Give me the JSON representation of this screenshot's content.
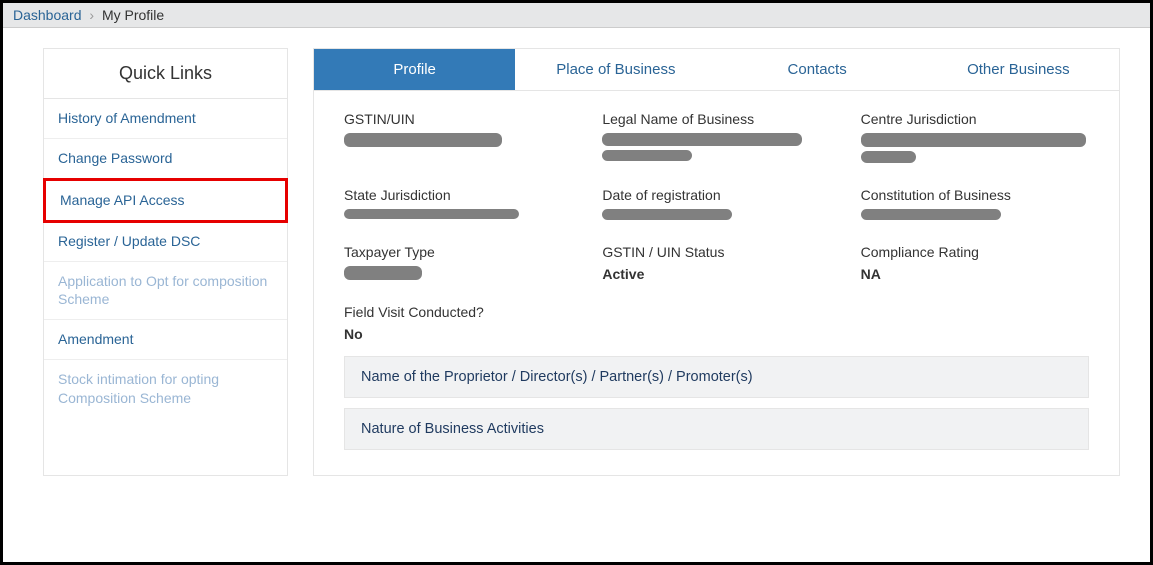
{
  "breadcrumb": {
    "dashboard": "Dashboard",
    "current": "My Profile"
  },
  "sidebar": {
    "title": "Quick Links",
    "items": [
      {
        "label": "History of Amendment",
        "disabled": false,
        "highlight": false
      },
      {
        "label": "Change Password",
        "disabled": false,
        "highlight": false
      },
      {
        "label": "Manage API Access",
        "disabled": false,
        "highlight": true
      },
      {
        "label": "Register / Update DSC",
        "disabled": false,
        "highlight": false
      },
      {
        "label": "Application to Opt for composition Scheme",
        "disabled": true,
        "highlight": false
      },
      {
        "label": "Amendment",
        "disabled": false,
        "highlight": false
      },
      {
        "label": "Stock intimation for opting Composition Scheme",
        "disabled": true,
        "highlight": false
      }
    ]
  },
  "tabs": [
    {
      "label": "Profile",
      "active": true
    },
    {
      "label": "Place of Business",
      "active": false
    },
    {
      "label": "Contacts",
      "active": false
    },
    {
      "label": "Other Business",
      "active": false
    }
  ],
  "profile": {
    "gstin_label": "GSTIN/UIN",
    "legal_name_label": "Legal Name of Business",
    "centre_jur_label": "Centre Jurisdiction",
    "state_jur_label": "State Jurisdiction",
    "reg_date_label": "Date of registration",
    "constitution_label": "Constitution of Business",
    "taxpayer_type_label": "Taxpayer Type",
    "gstin_status_label": "GSTIN / UIN Status",
    "gstin_status_value": "Active",
    "compliance_label": "Compliance Rating",
    "compliance_value": "NA",
    "field_visit_label": "Field Visit Conducted?",
    "field_visit_value": "No"
  },
  "accordions": [
    {
      "label": "Name of the Proprietor / Director(s) / Partner(s) / Promoter(s)"
    },
    {
      "label": "Nature of Business Activities"
    }
  ]
}
